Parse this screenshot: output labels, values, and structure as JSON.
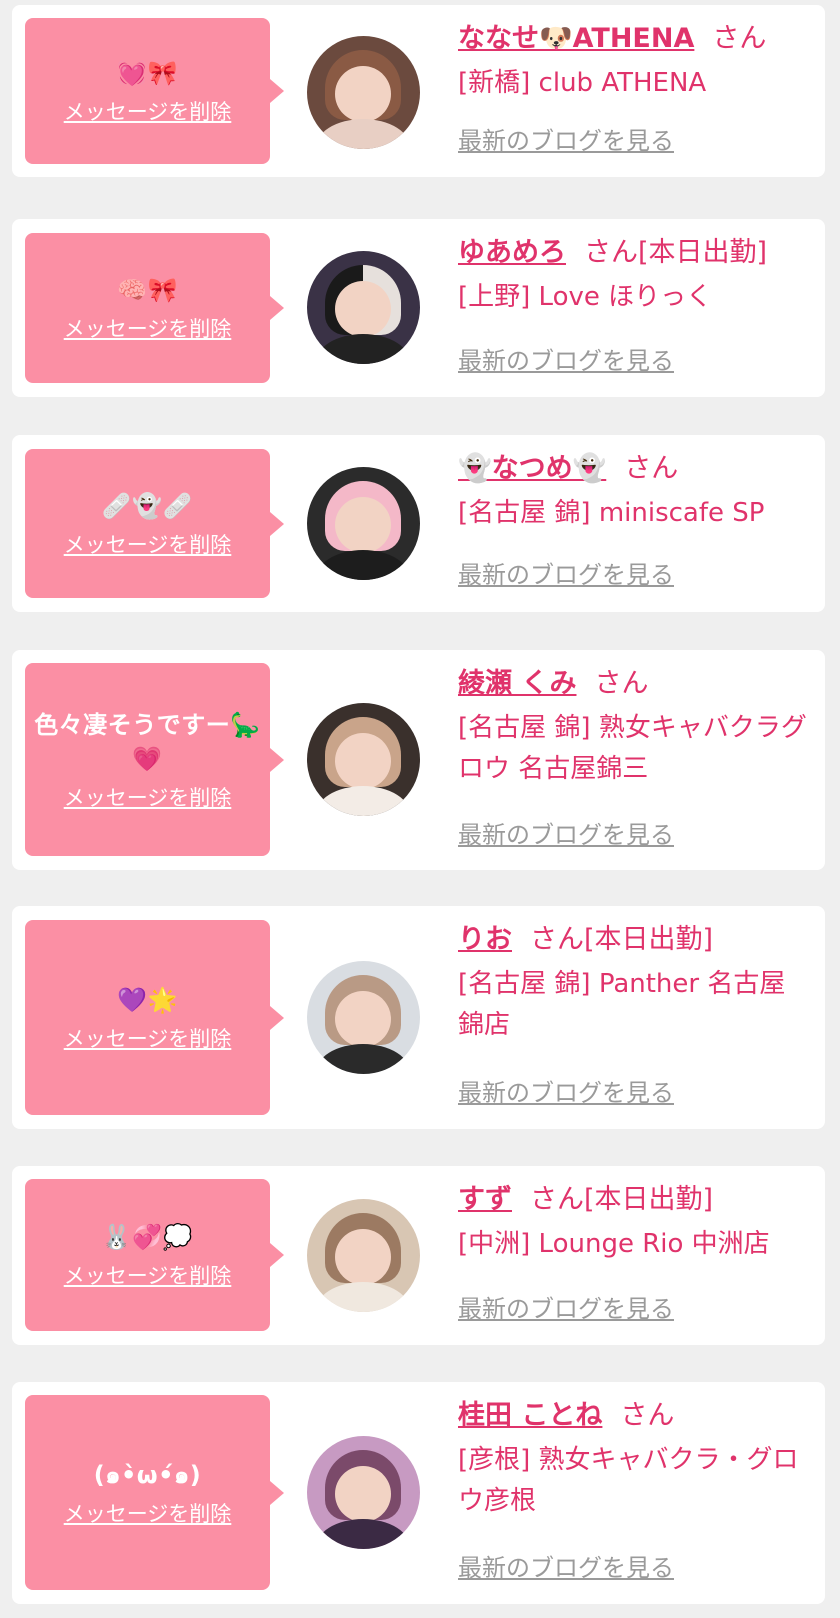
{
  "delete_label": "メッセージを削除",
  "san_label": "さん",
  "blog_label": "最新のブログを見る",
  "colors": {
    "accent": "#e0336b",
    "bubble": "#fb8fa4",
    "card": "#ffffff",
    "background": "#efefef",
    "link_gray": "#9a9a9a"
  },
  "items": [
    {
      "message": "💓🎀",
      "name": "ななせ🐶ATHENA",
      "status": "",
      "shop": "[新橋] club ATHENA",
      "avatar_icon": "profile-photo"
    },
    {
      "message": "🧠🎀",
      "name": "ゆあめろ",
      "status": "[本日出勤]",
      "shop": "[上野] Love ほりっく",
      "avatar_icon": "profile-photo"
    },
    {
      "message": "🩹👻🩹",
      "name": "👻なつめ👻",
      "status": "",
      "shop": "[名古屋 錦] miniscafe SP",
      "avatar_icon": "profile-photo"
    },
    {
      "message": "色々凄そうですー🦕💗",
      "name": "綾瀬 くみ",
      "status": "",
      "shop": "[名古屋 錦] 熟女キャバクラグロウ 名古屋錦三",
      "avatar_icon": "profile-photo"
    },
    {
      "message": "💜🌟",
      "name": "りお",
      "status": "[本日出勤]",
      "shop": "[名古屋 錦] Panther 名古屋錦店",
      "avatar_icon": "profile-photo"
    },
    {
      "message": "🐰💞💭",
      "name": "すず",
      "status": "[本日出勤]",
      "shop": "[中洲] Lounge Rio 中洲店",
      "avatar_icon": "profile-photo"
    },
    {
      "message": "(๑•̀ω•́๑)",
      "name": "桂田 ことね",
      "status": "",
      "shop": "[彦根] 熟女キャバクラ・グロウ彦根",
      "avatar_icon": "profile-photo"
    }
  ]
}
